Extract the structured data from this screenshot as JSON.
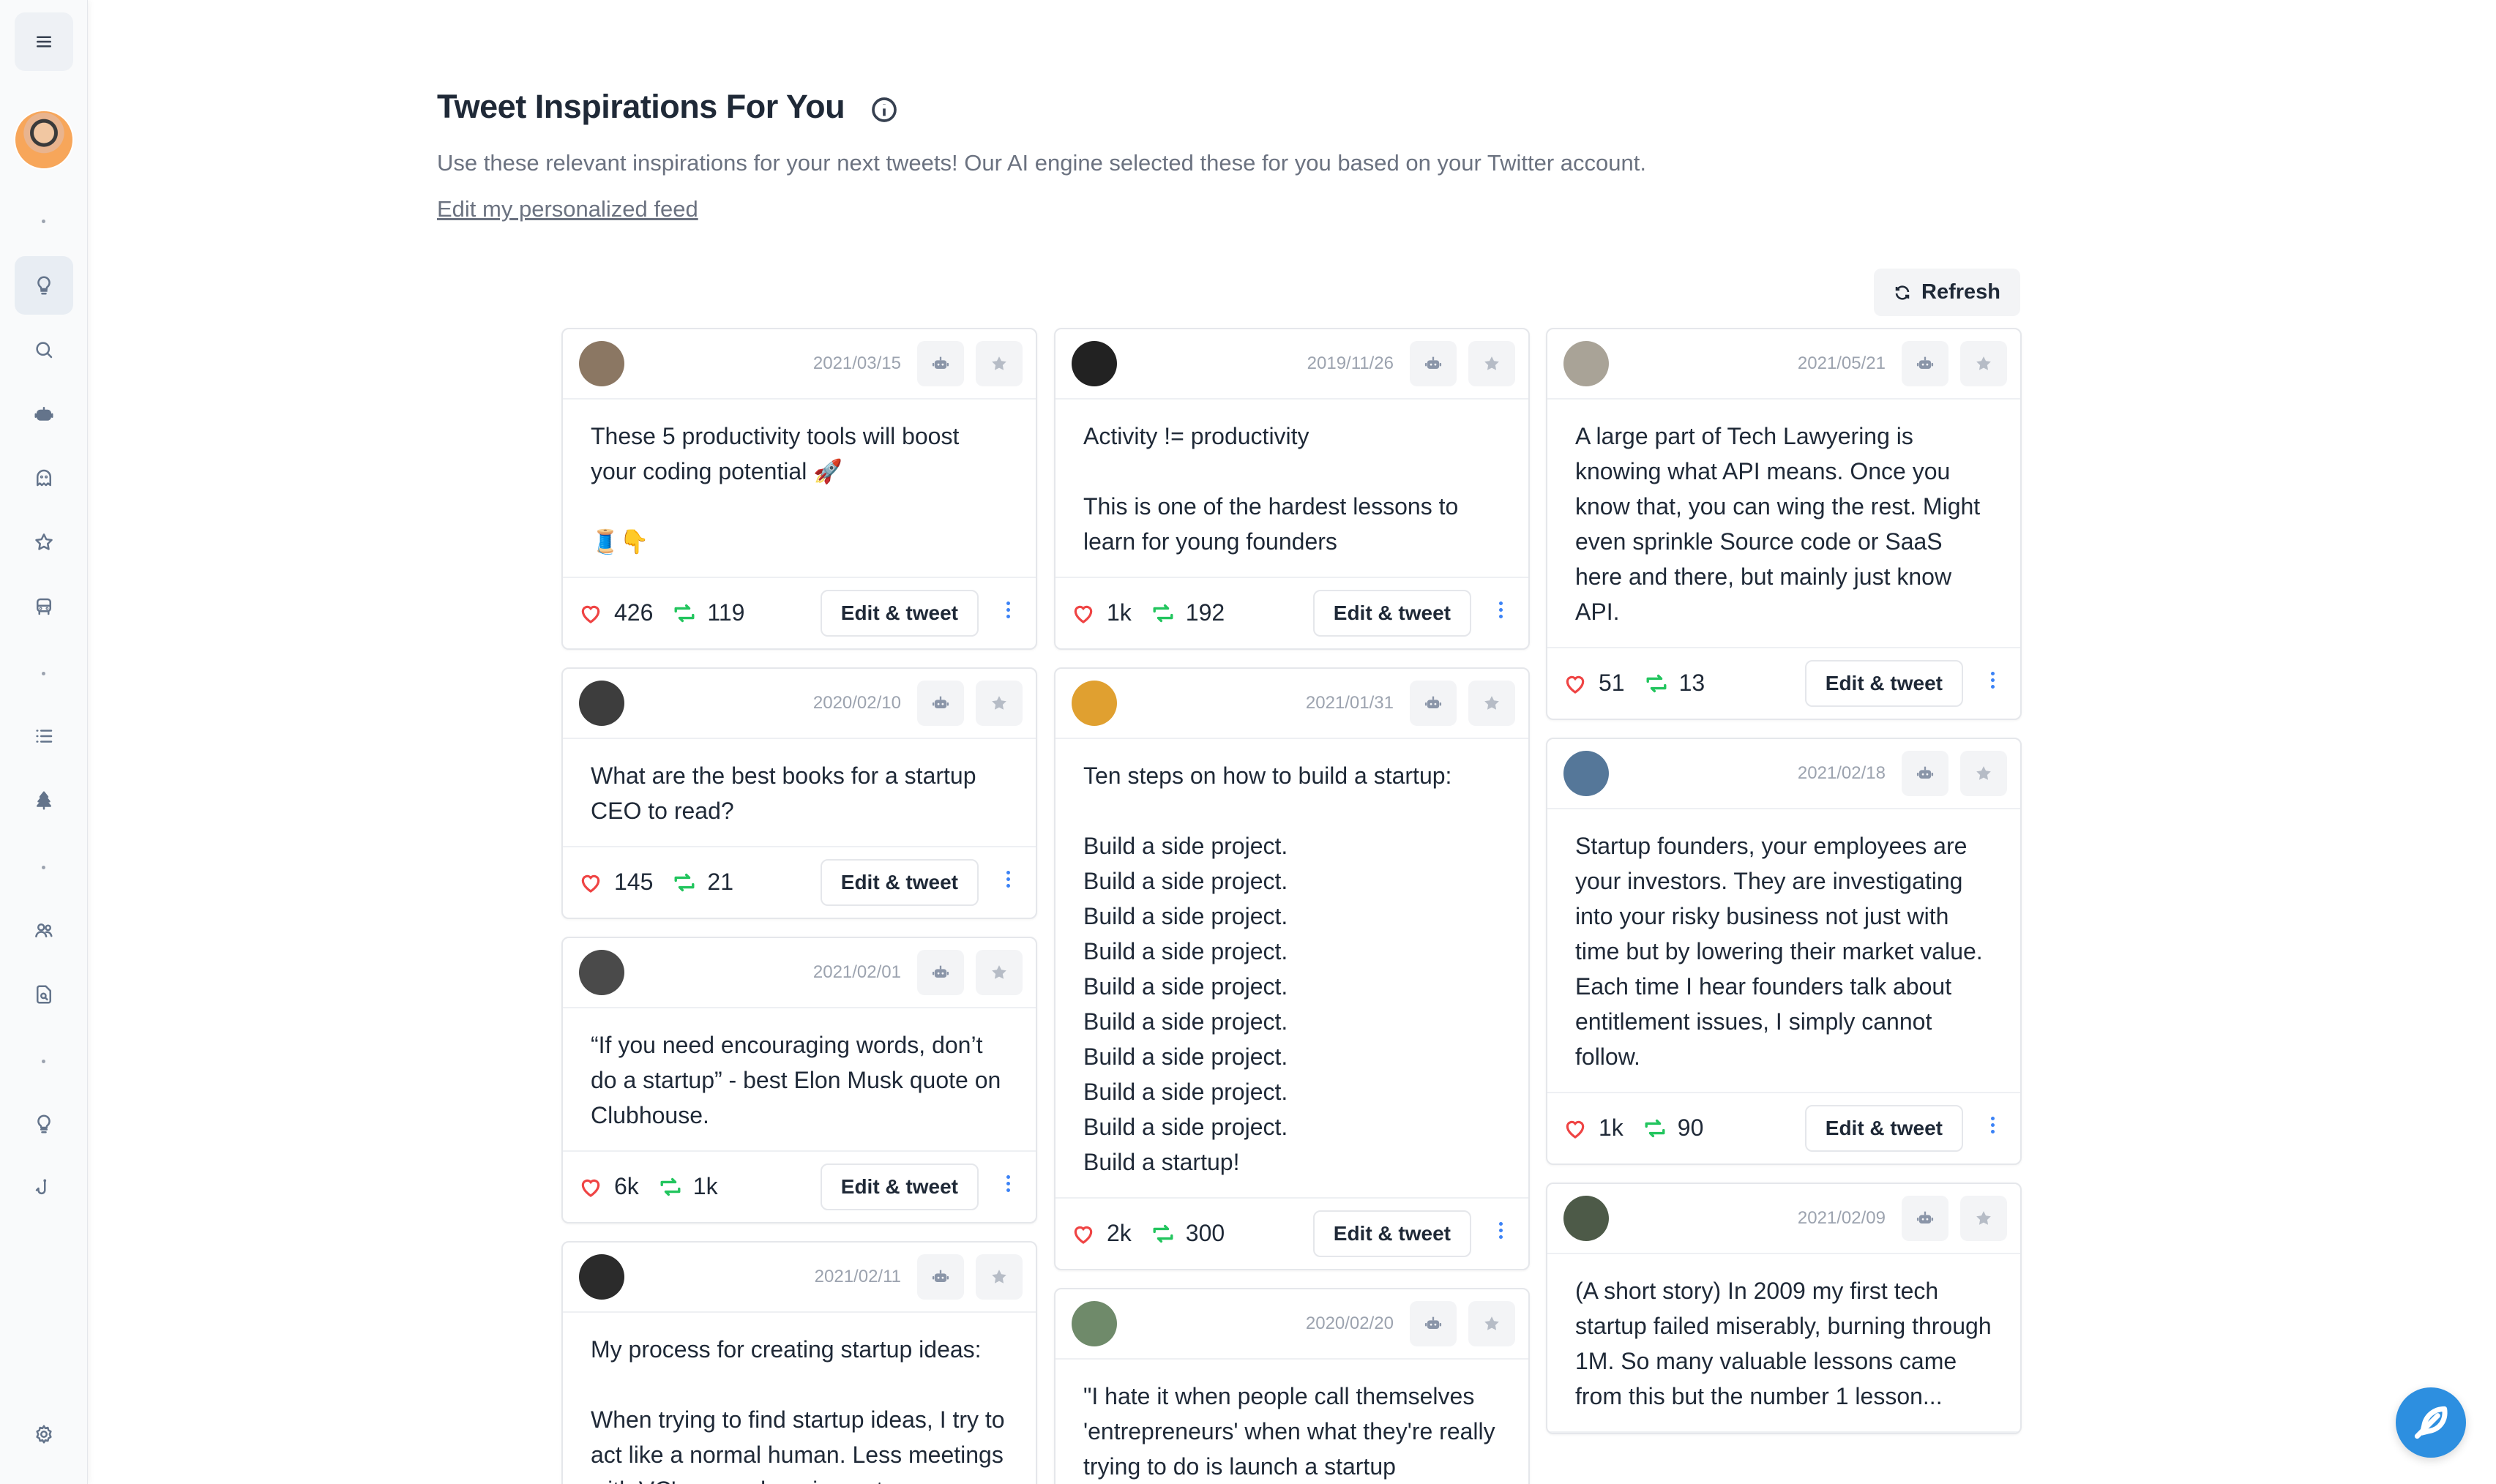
{
  "header": {
    "title": "Tweet Inspirations For You",
    "subtitle": "Use these relevant inspirations for your next tweets! Our AI engine selected these for you based on your Twitter account.",
    "edit_feed_link": "Edit my personalized feed",
    "refresh_label": "Refresh"
  },
  "card_actions": {
    "edit_label": "Edit & tweet"
  },
  "colors": {
    "heart": "#ef4444",
    "retweet": "#22c55e",
    "accent": "#2d8fe0",
    "more": "#3b82f6"
  },
  "sidebar": {
    "items": [
      "menu-icon",
      "avatar",
      "lightbulb-icon",
      "search-icon",
      "robot-icon",
      "ghost-icon",
      "star-icon",
      "bus-icon",
      "list-icon",
      "tree-icon",
      "users-icon",
      "file-search-icon",
      "lightbulb-icon",
      "hook-icon",
      "gear-icon"
    ]
  },
  "columns": [
    [
      {
        "date": "2021/03/15",
        "text": "These 5 productivity tools will boost your coding potential 🚀\n\n🧵👇",
        "likes": "426",
        "retweets": "119"
      },
      {
        "date": "2020/02/10",
        "text": "What are the best books for a startup CEO to read?",
        "likes": "145",
        "retweets": "21"
      },
      {
        "date": "2021/02/01",
        "text": "“If you need encouraging words, don’t do a startup” - best Elon Musk quote on Clubhouse.",
        "likes": "6k",
        "retweets": "1k"
      },
      {
        "date": "2021/02/11",
        "text": "My process for creating startup ideas:\n\nWhen trying to find startup ideas, I try to act like a normal human. Less meetings with VC's, more hanging out",
        "likes": "",
        "retweets": ""
      }
    ],
    [
      {
        "date": "2019/11/26",
        "text": "Activity != productivity\n\nThis is one of the hardest lessons to learn for young founders",
        "likes": "1k",
        "retweets": "192"
      },
      {
        "date": "2021/01/31",
        "text": "Ten steps on how to build a startup:\n\nBuild a side project.\nBuild a side project.\nBuild a side project.\nBuild a side project.\nBuild a side project.\nBuild a side project.\nBuild a side project.\nBuild a side project.\nBuild a side project.\nBuild a startup!",
        "likes": "2k",
        "retweets": "300"
      },
      {
        "date": "2020/02/20",
        "text": "\"I hate it when people call themselves 'entrepreneurs' when what they're really trying to do is launch a startup",
        "likes": "",
        "retweets": ""
      }
    ],
    [
      {
        "date": "2021/05/21",
        "text": "A large part of  Tech Lawyering is knowing what API means. Once you know that, you can wing the rest. Might even sprinkle Source code or SaaS here and there, but mainly just know API.",
        "likes": "51",
        "retweets": "13"
      },
      {
        "date": "2021/02/18",
        "text": "Startup founders, your employees are your investors. They are investigating into your risky business not just with time but by lowering their market value. Each time I hear founders talk about entitlement issues, I simply cannot follow.",
        "likes": "1k",
        "retweets": "90"
      },
      {
        "date": "2021/02/09",
        "text": "(A short story) In 2009 my first tech startup failed miserably, burning through 1M.  So many valuable lessons came from this but the number 1 lesson...",
        "likes": "",
        "retweets": ""
      }
    ]
  ]
}
